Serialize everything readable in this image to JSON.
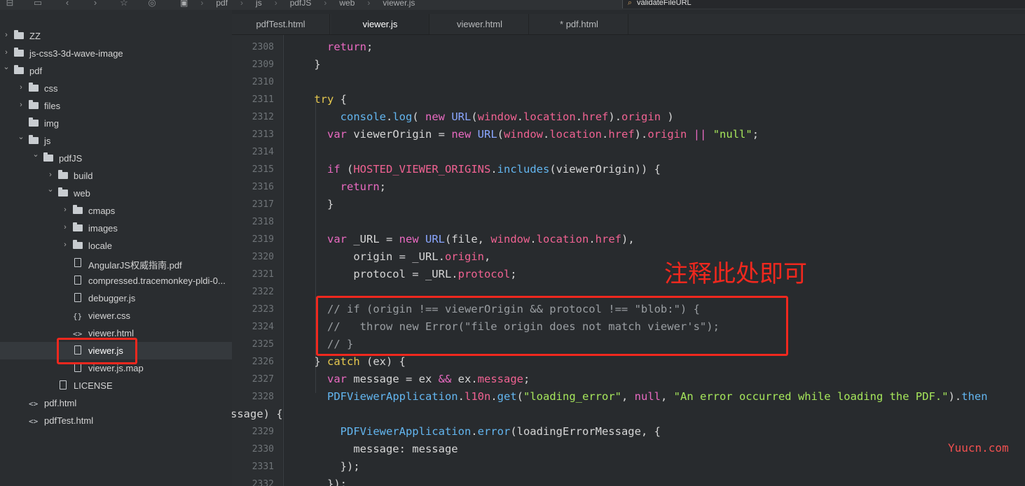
{
  "breadcrumb": [
    "pdf",
    "js",
    "pdfJS",
    "web",
    "viewer.js"
  ],
  "search": {
    "value": "validateFileURL"
  },
  "tabs": [
    {
      "label": "pdfTest.html",
      "active": false
    },
    {
      "label": "viewer.js",
      "active": true
    },
    {
      "label": "viewer.html",
      "active": false
    },
    {
      "label": "* pdf.html",
      "active": false
    }
  ],
  "tree": [
    {
      "label": "ZZ",
      "type": "folder",
      "depth": 0,
      "arrow": "right"
    },
    {
      "label": "js-css3-3d-wave-image",
      "type": "folder",
      "depth": 0,
      "arrow": "right"
    },
    {
      "label": "pdf",
      "type": "folder",
      "depth": 0,
      "arrow": "down"
    },
    {
      "label": "css",
      "type": "folder",
      "depth": 1,
      "arrow": "right"
    },
    {
      "label": "files",
      "type": "folder",
      "depth": 1,
      "arrow": "right"
    },
    {
      "label": "img",
      "type": "folder",
      "depth": 1,
      "arrow": ""
    },
    {
      "label": "js",
      "type": "folder",
      "depth": 1,
      "arrow": "down"
    },
    {
      "label": "pdfJS",
      "type": "folder",
      "depth": 2,
      "arrow": "down"
    },
    {
      "label": "build",
      "type": "folder",
      "depth": 3,
      "arrow": "right"
    },
    {
      "label": "web",
      "type": "folder",
      "depth": 3,
      "arrow": "down"
    },
    {
      "label": "cmaps",
      "type": "folder",
      "depth": 4,
      "arrow": "right"
    },
    {
      "label": "images",
      "type": "folder",
      "depth": 4,
      "arrow": "right"
    },
    {
      "label": "locale",
      "type": "folder",
      "depth": 4,
      "arrow": "right"
    },
    {
      "label": "AngularJS权威指南.pdf",
      "type": "file",
      "depth": 4,
      "arrow": ""
    },
    {
      "label": "compressed.tracemonkey-pldi-0...",
      "type": "file",
      "depth": 4,
      "arrow": ""
    },
    {
      "label": "debugger.js",
      "type": "file",
      "depth": 4,
      "arrow": ""
    },
    {
      "label": "viewer.css",
      "type": "css",
      "depth": 4,
      "arrow": ""
    },
    {
      "label": "viewer.html",
      "type": "html",
      "depth": 4,
      "arrow": ""
    },
    {
      "label": "viewer.js",
      "type": "js",
      "depth": 4,
      "arrow": "",
      "selected": true
    },
    {
      "label": "viewer.js.map",
      "type": "file",
      "depth": 4,
      "arrow": ""
    },
    {
      "label": "LICENSE",
      "type": "file",
      "depth": 3,
      "arrow": ""
    },
    {
      "label": "pdf.html",
      "type": "html",
      "depth": 1,
      "arrow": ""
    },
    {
      "label": "pdfTest.html",
      "type": "html",
      "depth": 1,
      "arrow": ""
    }
  ],
  "code_lines": [
    {
      "n": "2308",
      "html": "      <span class='kw2'>return</span>;"
    },
    {
      "n": "2309",
      "html": "    }"
    },
    {
      "n": "2310",
      "html": ""
    },
    {
      "n": "2311",
      "html": "    <span class='kw-try'>try</span> {"
    },
    {
      "n": "2312",
      "html": "        <span class='fn'>console</span>.<span class='fn'>log</span>( <span class='kw2'>new</span> <span class='cls'>URL</span>(<span class='prop'>window</span>.<span class='prop'>location</span>.<span class='prop'>href</span>).<span class='prop'>origin</span> )"
    },
    {
      "n": "2313",
      "html": "      <span class='kw2'>var</span> viewerOrigin = <span class='kw2'>new</span> <span class='cls'>URL</span>(<span class='prop'>window</span>.<span class='prop'>location</span>.<span class='prop'>href</span>).<span class='prop'>origin</span> <span class='kw2'>||</span> <span class='str'>\"null\"</span>;"
    },
    {
      "n": "2314",
      "html": ""
    },
    {
      "n": "2315",
      "html": "      <span class='kw2'>if</span> (<span class='prop'>HOSTED_VIEWER_ORIGINS</span>.<span class='fn'>includes</span>(viewerOrigin)) {"
    },
    {
      "n": "2316",
      "html": "        <span class='kw2'>return</span>;"
    },
    {
      "n": "2317",
      "html": "      }"
    },
    {
      "n": "2318",
      "html": ""
    },
    {
      "n": "2319",
      "html": "      <span class='kw2'>var</span> _URL = <span class='kw2'>new</span> <span class='cls'>URL</span>(file, <span class='prop'>window</span>.<span class='prop'>location</span>.<span class='prop'>href</span>),"
    },
    {
      "n": "2320",
      "html": "          origin = _URL.<span class='prop'>origin</span>,"
    },
    {
      "n": "2321",
      "html": "          protocol = _URL.<span class='prop'>protocol</span>;"
    },
    {
      "n": "2322",
      "html": ""
    },
    {
      "n": "2323",
      "html": "      <span class='cm'>// if (origin !== viewerOrigin &amp;&amp; protocol !== \"blob:\") {</span>"
    },
    {
      "n": "2324",
      "html": "      <span class='cm'>//   throw new Error(\"file origin does not match viewer's\");</span>"
    },
    {
      "n": "2325",
      "html": "      <span class='cm'>// }</span>"
    },
    {
      "n": "2326",
      "html": "    } <span class='kw'>catch</span> (ex) {"
    },
    {
      "n": "2327",
      "html": "      <span class='kw2'>var</span> message = ex <span class='kw2'>&amp;&amp;</span> ex.<span class='prop'>message</span>;"
    },
    {
      "n": "2328",
      "html": "      <span class='fn'>PDFViewerApplication</span>.<span class='prop'>l10n</span>.<span class='fn'>get</span>(<span class='str'>\"loading_error\"</span>, <span class='kw2'>null</span>, <span class='str'>\"An error occurred while loading the PDF.\"</span>).<span class='fn'>then</span>"
    },
    {
      "n": "",
      "html": "ssage) {",
      "wrap": true
    },
    {
      "n": "2329",
      "html": "        <span class='fn'>PDFViewerApplication</span>.<span class='fn'>error</span>(loadingErrorMessage, {"
    },
    {
      "n": "2330",
      "html": "          message: message"
    },
    {
      "n": "2331",
      "html": "        });"
    },
    {
      "n": "2332",
      "html": "      });"
    }
  ],
  "annotation": {
    "text": "注释此处即可"
  },
  "watermark": "Yuucn.com",
  "colors": {
    "highlight": "#f0281e",
    "background": "#282b2e"
  }
}
